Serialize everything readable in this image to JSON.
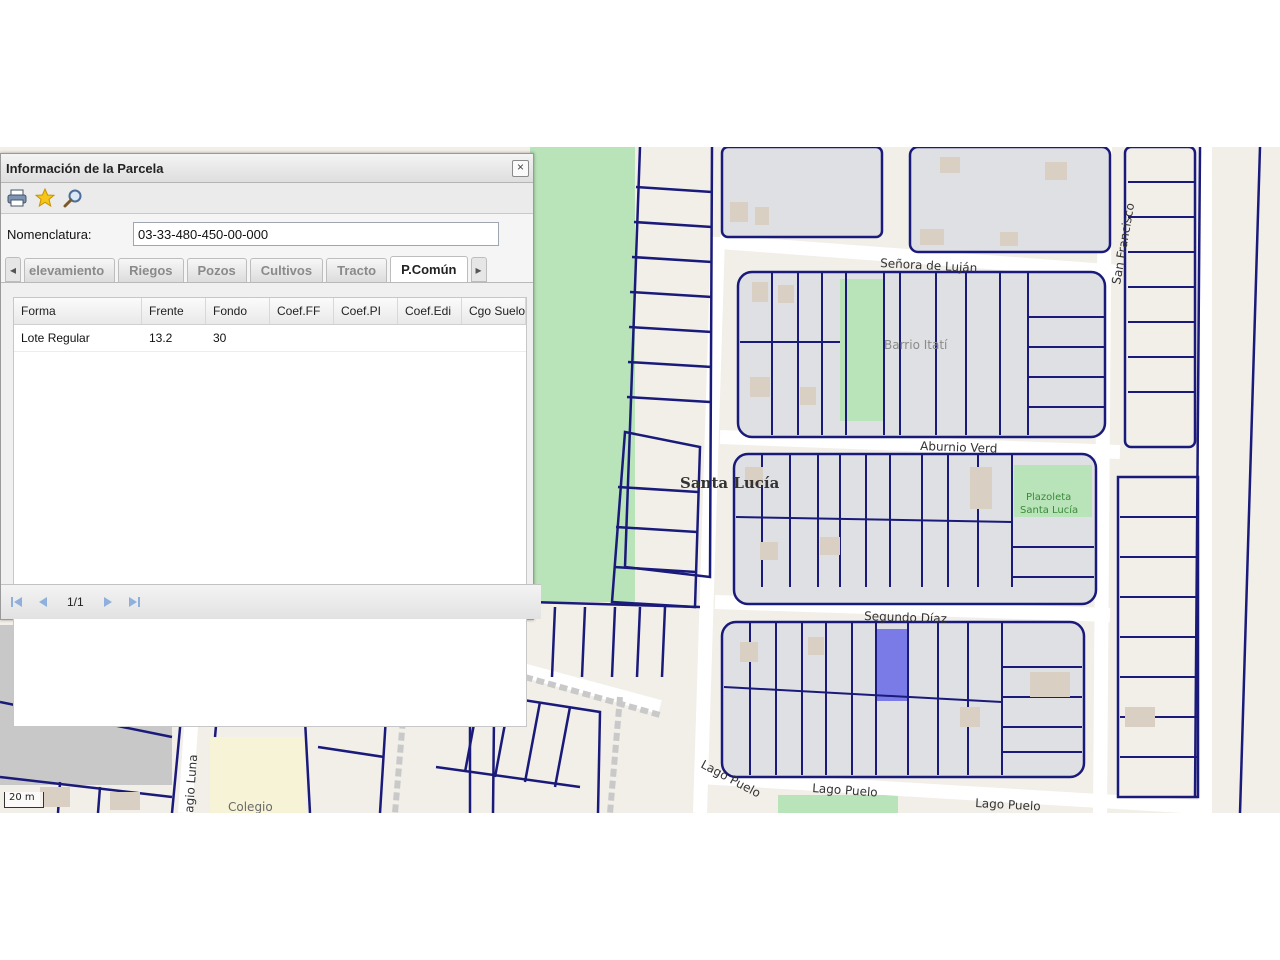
{
  "panel": {
    "title": "Información de la Parcela",
    "close_label": "×",
    "nomenclatura_label": "Nomenclatura:",
    "nomenclatura_value": "03-33-480-450-00-000",
    "tabs": [
      "elevamiento",
      "Riegos",
      "Pozos",
      "Cultivos",
      "Tracto",
      "P.Común"
    ],
    "active_tab": "P.Común",
    "grid": {
      "columns": [
        "Forma",
        "Frente",
        "Fondo",
        "Coef.FF",
        "Coef.PI",
        "Coef.Edi",
        "Cgo Suelo"
      ],
      "rows": [
        [
          "Lote Regular",
          "13.2",
          "30",
          "",
          "",
          "",
          ""
        ]
      ]
    },
    "pager": {
      "page_info": "1/1"
    },
    "icons": [
      "print-icon",
      "star-icon",
      "search-icon",
      "first-page-icon",
      "prev-page-icon",
      "next-page-icon",
      "last-page-icon"
    ]
  },
  "map": {
    "labels": {
      "senora_de_lujan": "Señora de Luján",
      "san_francisco": "San Francisco",
      "barrio_itati": "Barrio Itatí",
      "aburnio_verd": "Aburnio Verd",
      "santa_lucia": "Santa Lucía",
      "plazoleta_1": "Plazoleta",
      "plazoleta_2": "Santa Lucía",
      "segundo_diaz": "Segundo Díaz",
      "lago_puelo_1": "Lago Puelo",
      "lago_puelo_2": "Lago Puelo",
      "lago_puelo_3": "Lago Puelo",
      "ragio_luna": "agio Luna",
      "colegio": "Colegio"
    },
    "scale_label": "20 m",
    "colors": {
      "parcel_line": "#1a1a7a",
      "block_fill": "#dfe0e3",
      "selected_parcel": "#7b7be8",
      "green_area": "#b9e3b8",
      "building": "#d9cfc3"
    }
  }
}
